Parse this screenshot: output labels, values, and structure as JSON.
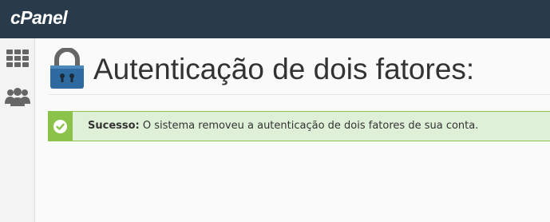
{
  "brand": {
    "logo": "cPanel"
  },
  "sidebar": {
    "items": [
      {
        "icon": "grid-icon"
      },
      {
        "icon": "users-icon"
      }
    ]
  },
  "page": {
    "title": "Autenticação de dois fatores:"
  },
  "alert": {
    "label": "Sucesso:",
    "message": " O sistema removeu a autenticação de dois fatores de sua conta.",
    "status_color": "#8bc34a"
  },
  "colors": {
    "topbar": "#293a4a",
    "lock": "#2d6a9f"
  }
}
